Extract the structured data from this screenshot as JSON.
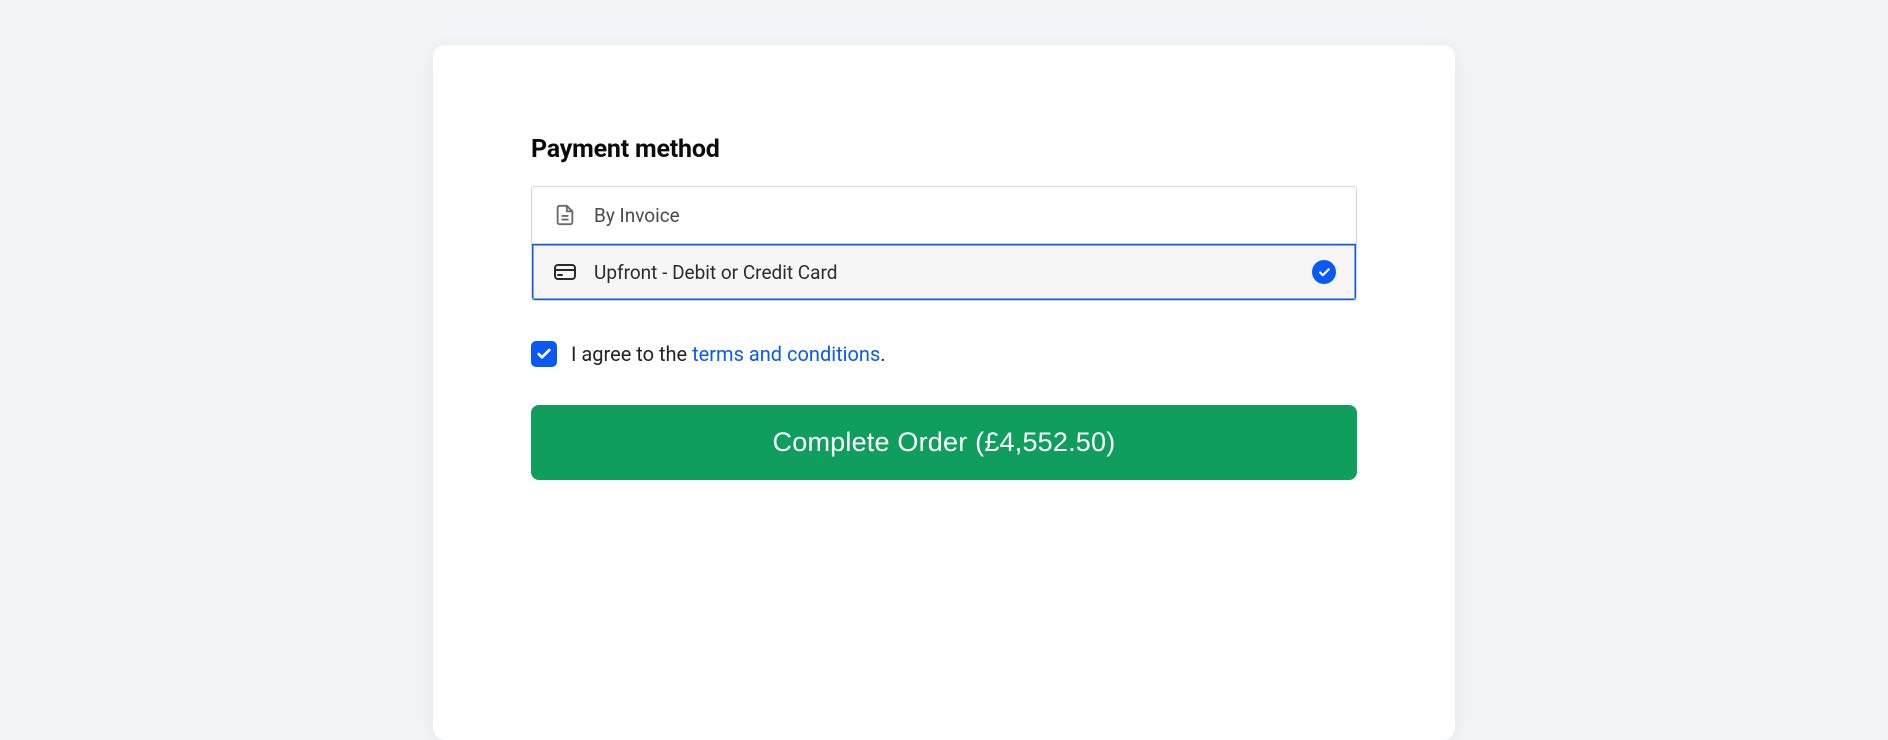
{
  "section_title": "Payment method",
  "options": [
    {
      "label": "By Invoice",
      "selected": false
    },
    {
      "label": "Upfront - Debit or Credit Card",
      "selected": true
    }
  ],
  "consent": {
    "prefix": "I agree to the ",
    "link_text": "terms and conditions",
    "suffix": ".",
    "checked": true
  },
  "submit": {
    "label_prefix": "Complete Order",
    "amount": "£4,552.50"
  }
}
